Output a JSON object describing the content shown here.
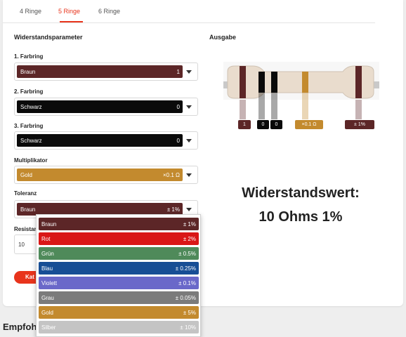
{
  "tabs": [
    {
      "label": "4 Ringe",
      "active": false
    },
    {
      "label": "5 Ringe",
      "active": true
    },
    {
      "label": "6 Ringe",
      "active": false
    }
  ],
  "params_title": "Widerstandsparameter",
  "output_title": "Ausgabe",
  "fields": [
    {
      "label": "1. Farbring",
      "name": "Braun",
      "value": "1",
      "color": "#5c2627"
    },
    {
      "label": "2. Farbring",
      "name": "Schwarz",
      "value": "0",
      "color": "#0a0a0a"
    },
    {
      "label": "3. Farbring",
      "name": "Schwarz",
      "value": "0",
      "color": "#0a0a0a"
    },
    {
      "label": "Multiplikator",
      "name": "Gold",
      "value": "×0.1 Ω",
      "color": "#c38a2e"
    },
    {
      "label": "Toleranz",
      "name": "Braun",
      "value": "± 1%",
      "color": "#5c2627"
    }
  ],
  "resistance_label": "Resistan",
  "resistance_input": {
    "value": "10"
  },
  "calc_button": "Kat",
  "tolerance_options": [
    {
      "name": "Braun",
      "value": "± 1%",
      "color": "#5c2627"
    },
    {
      "name": "Rot",
      "value": "± 2%",
      "color": "#d91717"
    },
    {
      "name": "Grün",
      "value": "± 0.5%",
      "color": "#4f8a5a"
    },
    {
      "name": "Blau",
      "value": "± 0.25%",
      "color": "#174e95"
    },
    {
      "name": "Violett",
      "value": "± 0.1%",
      "color": "#6a68c9"
    },
    {
      "name": "Grau",
      "value": "± 0.05%",
      "color": "#7b7b7b"
    },
    {
      "name": "Gold",
      "value": "± 5%",
      "color": "#c38a2e"
    },
    {
      "name": "Silber",
      "value": "± 10%",
      "color": "#c4c4c4"
    }
  ],
  "band_chips": [
    {
      "text": "1",
      "color": "#5c2627"
    },
    {
      "text": "0",
      "color": "#0a0a0a"
    },
    {
      "text": "0",
      "color": "#0a0a0a"
    },
    {
      "text": "×0.1 Ω",
      "color": "#c38a2e"
    },
    {
      "text": "± 1%",
      "color": "#5c2627"
    }
  ],
  "result_title": "Widerstandswert:",
  "result_value": "10 Ohms 1%",
  "footer_heading": "Empfoh"
}
